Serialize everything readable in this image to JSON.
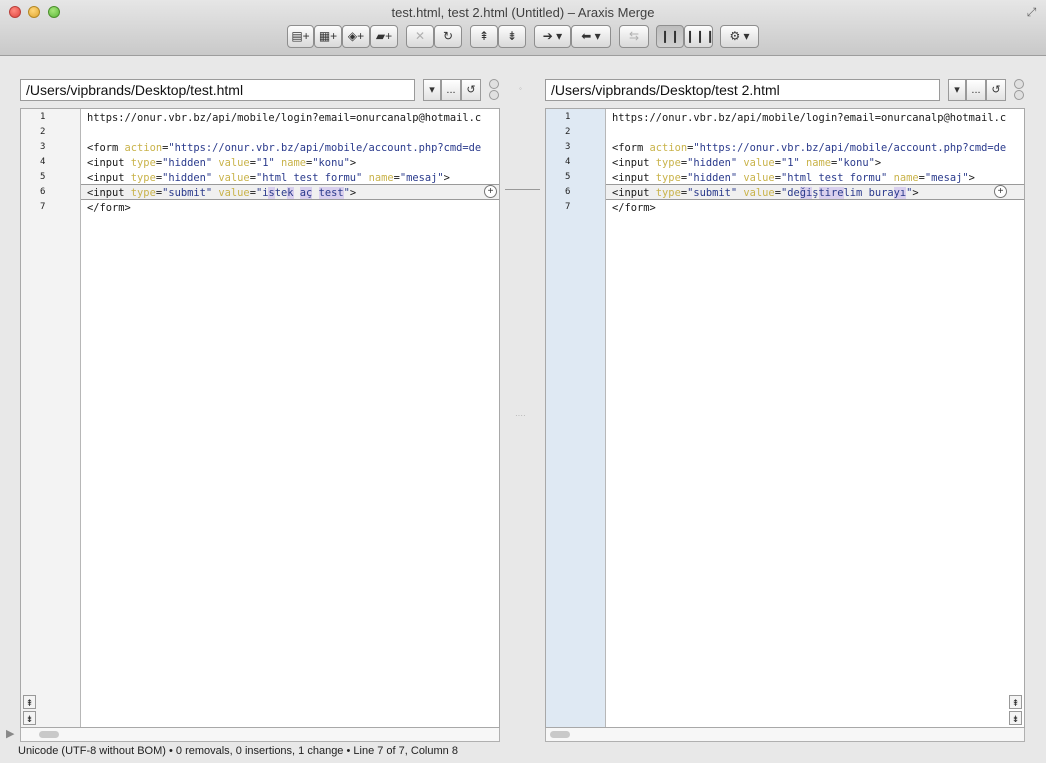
{
  "window": {
    "title": "test.html, test 2.html (Untitled) – Araxis Merge"
  },
  "toolbar": {
    "buttons": [
      {
        "name": "new-file-comparison-button",
        "glyph": "▤+"
      },
      {
        "name": "new-binary-comparison-button",
        "glyph": "▦+"
      },
      {
        "name": "new-image-comparison-button",
        "glyph": "◈+"
      },
      {
        "name": "new-folder-comparison-button",
        "glyph": "▰+"
      },
      {
        "name": "close-button",
        "glyph": "✕"
      },
      {
        "name": "refresh-button",
        "glyph": "↻"
      },
      {
        "name": "previous-change-button",
        "glyph": "⇞"
      },
      {
        "name": "next-change-button",
        "glyph": "⇟"
      },
      {
        "name": "merge-right-button",
        "glyph": "➔ ▾"
      },
      {
        "name": "merge-left-button",
        "glyph": "⬅ ▾"
      },
      {
        "name": "swap-files-button",
        "glyph": "⇆"
      },
      {
        "name": "two-way-view-button",
        "glyph": "❙❙"
      },
      {
        "name": "three-way-view-button",
        "glyph": "❙❙❙"
      },
      {
        "name": "settings-button",
        "glyph": "⚙ ▾"
      }
    ]
  },
  "left": {
    "path": "/Users/vipbrands/Desktop/test.html",
    "lines": [
      {
        "n": "1"
      },
      {
        "n": "2"
      },
      {
        "n": "3"
      },
      {
        "n": "4"
      },
      {
        "n": "5"
      },
      {
        "n": "6"
      },
      {
        "n": "7"
      }
    ],
    "code": {
      "l1": "https://onur.vbr.bz/api/mobile/login?email=onurcanalp@hotmail.c",
      "l3a": "<form ",
      "l3b": "action",
      "l3c": "=",
      "l3d": "\"https://onur.vbr.bz/api/mobile/account.php?cmd=de",
      "l4a": "<input ",
      "l4b": "type",
      "l4c": "=",
      "l4d": "\"hidden\"",
      "l4e": " ",
      "l4f": "value",
      "l4g": "=",
      "l4h": "\"1\"",
      "l4i": " ",
      "l4j": "name",
      "l4k": "=",
      "l4l": "\"konu\"",
      "l4m": ">",
      "l5a": "<input ",
      "l5b": "type",
      "l5c": "=",
      "l5d": "\"hidden\"",
      "l5e": " ",
      "l5f": "value",
      "l5g": "=",
      "l5h": "\"html test formu\"",
      "l5i": " ",
      "l5j": "name",
      "l5k": "=",
      "l5l": "\"mesaj\"",
      "l5m": ">",
      "l6a": "<input ",
      "l6b": "type",
      "l6c": "=",
      "l6d": "\"submit\"",
      "l6e": " ",
      "l6f": "value",
      "l6g": "=",
      "l6h1": "\"i",
      "l6h2": "s",
      "l6h3": "te",
      "l6h4": "k",
      "l6h5": " ",
      "l6h6": "aç",
      "l6h7": " ",
      "l6h8": "test",
      "l6h9": "\"",
      "l6m": ">",
      "l7": "</form>"
    }
  },
  "right": {
    "path": "/Users/vipbrands/Desktop/test 2.html",
    "lines": [
      {
        "n": "1"
      },
      {
        "n": "2"
      },
      {
        "n": "3"
      },
      {
        "n": "4"
      },
      {
        "n": "5"
      },
      {
        "n": "6"
      },
      {
        "n": "7"
      }
    ],
    "code": {
      "l1": "https://onur.vbr.bz/api/mobile/login?email=onurcanalp@hotmail.c",
      "l3a": "<form ",
      "l3b": "action",
      "l3c": "=",
      "l3d": "\"https://onur.vbr.bz/api/mobile/account.php?cmd=de",
      "l4a": "<input ",
      "l4b": "type",
      "l4c": "=",
      "l4d": "\"hidden\"",
      "l4e": " ",
      "l4f": "value",
      "l4g": "=",
      "l4h": "\"1\"",
      "l4i": " ",
      "l4j": "name",
      "l4k": "=",
      "l4l": "\"konu\"",
      "l4m": ">",
      "l5a": "<input ",
      "l5b": "type",
      "l5c": "=",
      "l5d": "\"hidden\"",
      "l5e": " ",
      "l5f": "value",
      "l5g": "=",
      "l5h": "\"html test formu\"",
      "l5i": " ",
      "l5j": "name",
      "l5k": "=",
      "l5l": "\"mesaj\"",
      "l5m": ">",
      "l6a": "<input ",
      "l6b": "type",
      "l6c": "=",
      "l6d": "\"submit\"",
      "l6e": " ",
      "l6f": "value",
      "l6g": "=",
      "l6h1": "\"de",
      "l6h2": "ği",
      "l6h3": "ş",
      "l6h4": "tire",
      "l6h5": "lim",
      "l6h6": " ",
      "l6h7": "bura",
      "l6h8": "yı",
      "l6h9": "\"",
      "l6m": ">",
      "l7": "</form>"
    }
  },
  "path_buttons": {
    "dropdown": "▾",
    "browse": "...",
    "history": "↺"
  },
  "diff_marker": "+",
  "status": {
    "text": "Unicode (UTF-8 without BOM) • 0 removals, 0 insertions, 1 change • Line 7 of 7, Column 8"
  },
  "colors": {
    "change_highlight": "#d9d0ee",
    "attribute": "#c9b34a",
    "value": "#2a3a8c",
    "right_gutter": "#dfe9f3"
  }
}
